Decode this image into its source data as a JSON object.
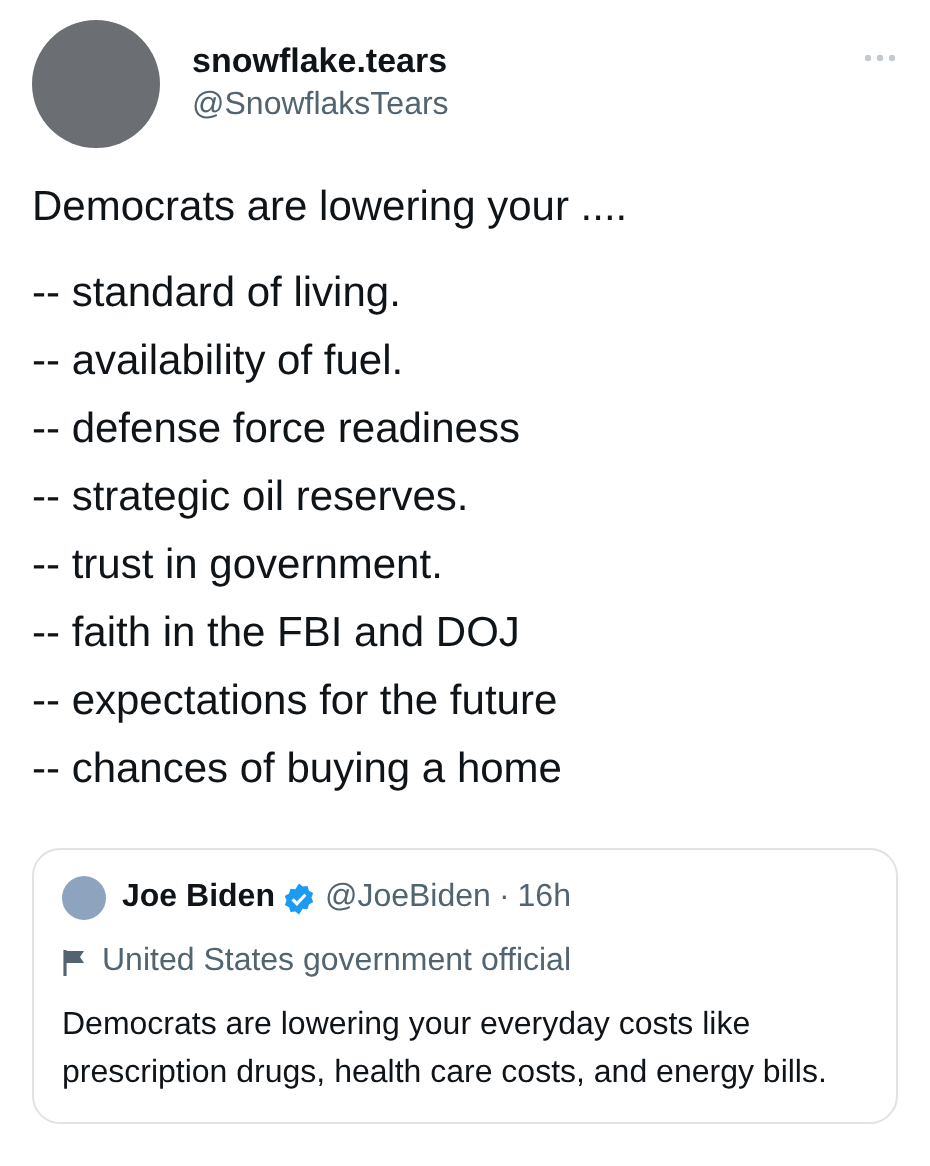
{
  "author": {
    "name": "snowflake.tears",
    "handle": "@SnowflaksTears"
  },
  "tweet": {
    "intro": "Democrats are lowering your ....",
    "lines": [
      "-- standard of living.",
      "-- availability of fuel.",
      "-- defense force readiness",
      "-- strategic oil reserves.",
      "-- trust in government.",
      "-- faith in the FBI and DOJ",
      "-- expectations for the future",
      "-- chances of buying a home"
    ]
  },
  "quoted_tweet": {
    "name": "Joe Biden",
    "verified": true,
    "handle": "@JoeBiden",
    "separator": "·",
    "time": "16h",
    "label": "United States government official",
    "text": "Democrats are lowering your everyday costs like prescription drugs, health care costs, and energy bills."
  }
}
